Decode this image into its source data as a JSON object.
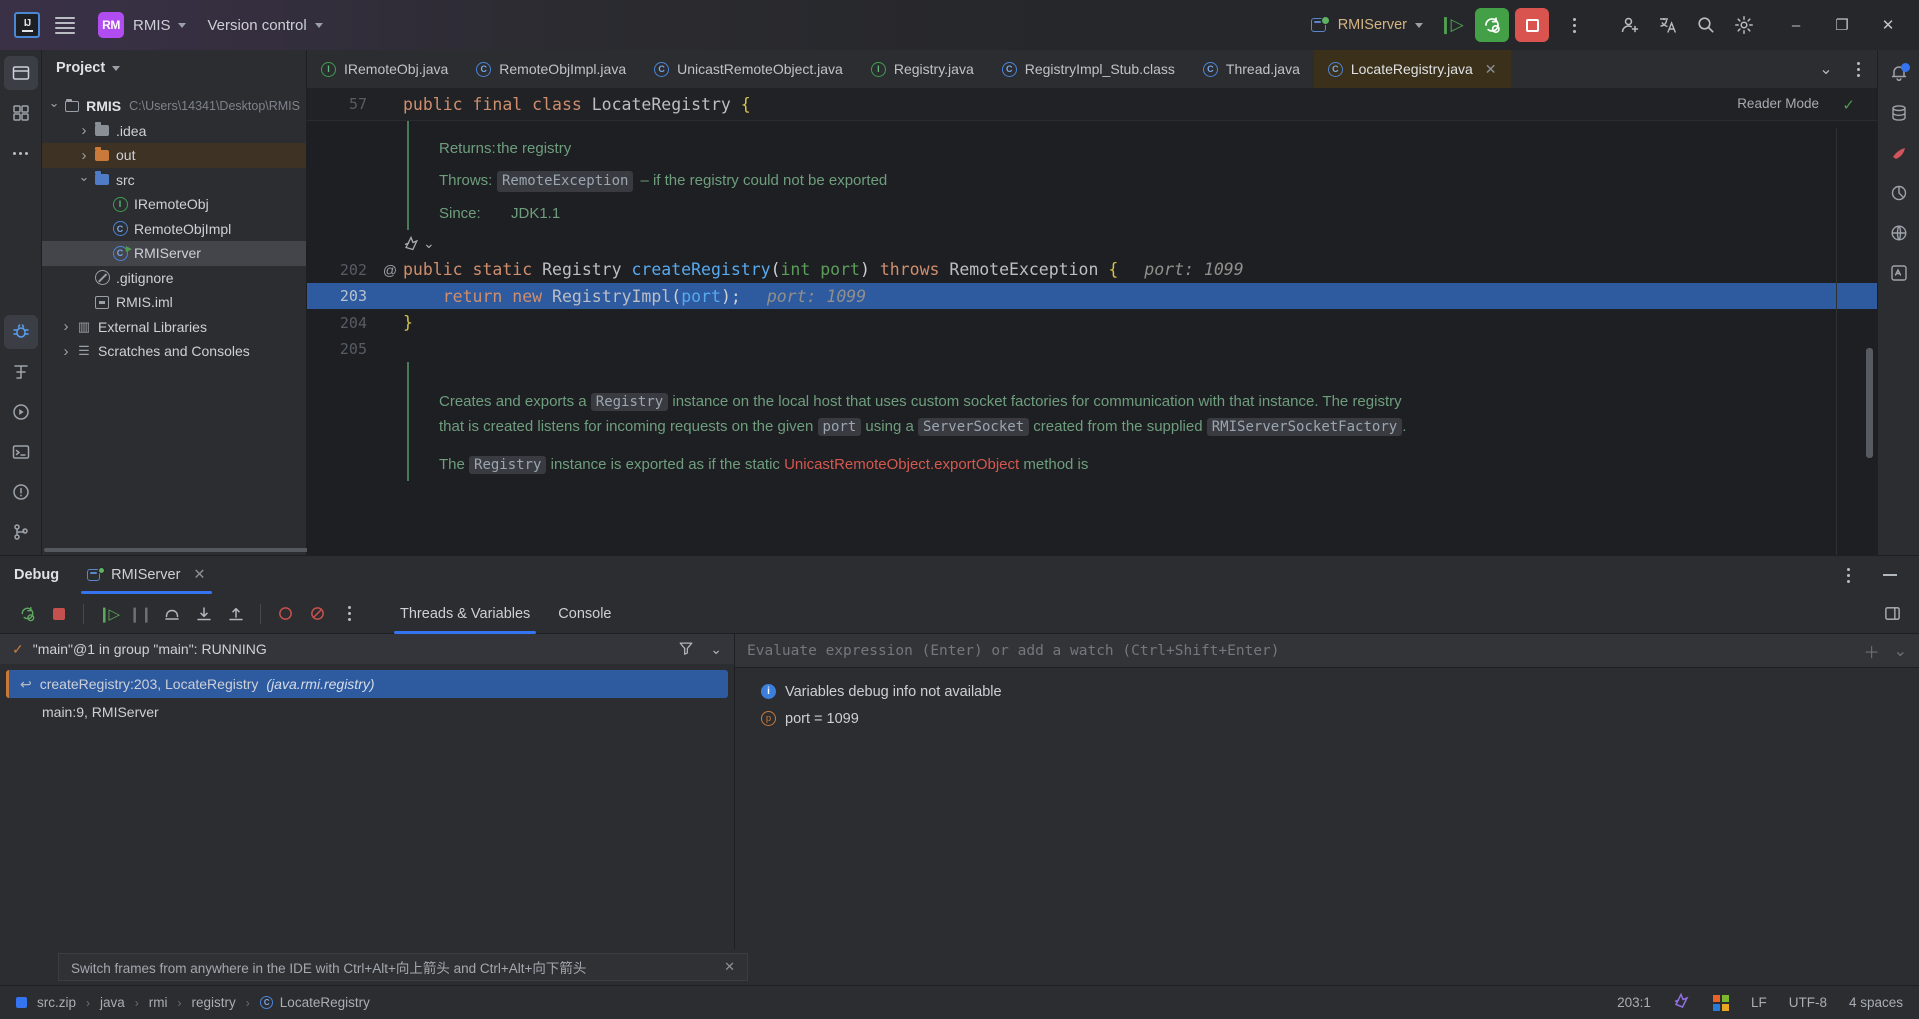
{
  "titlebar": {
    "menu_icon": "hamburger-icon",
    "project_badge": "RM",
    "project_name": "RMIS",
    "vcs_label": "Version control",
    "run_config": "RMIServer",
    "buttons": {
      "resume": "resume-program",
      "debug": "rerun-debug",
      "stop": "stop",
      "more": "more-actions",
      "account": "account",
      "translate": "translate",
      "search": "search",
      "settings": "settings",
      "minimize": "–",
      "maximize": "❐",
      "close": "✕"
    }
  },
  "project": {
    "header": "Project",
    "items": [
      {
        "label": "RMIS",
        "path": "C:\\Users\\14341\\Desktop\\RMIS",
        "icon": "module-folder-icon",
        "arrow": "down",
        "indent": 0,
        "bold": true,
        "state": "normal"
      },
      {
        "label": ".idea",
        "path": "",
        "icon": "folder-grey-icon",
        "arrow": "right",
        "indent": 1,
        "bold": false,
        "state": "normal"
      },
      {
        "label": "out",
        "path": "",
        "icon": "folder-orange-icon",
        "arrow": "right",
        "indent": 1,
        "bold": false,
        "state": "sel-out"
      },
      {
        "label": "src",
        "path": "",
        "icon": "folder-blue-icon",
        "arrow": "down",
        "indent": 1,
        "bold": false,
        "state": "normal"
      },
      {
        "label": "IRemoteObj",
        "path": "",
        "icon": "interface-icon",
        "arrow": "none",
        "indent": 2,
        "bold": false,
        "state": "normal"
      },
      {
        "label": "RemoteObjImpl",
        "path": "",
        "icon": "class-icon",
        "arrow": "none",
        "indent": 2,
        "bold": false,
        "state": "normal"
      },
      {
        "label": "RMIServer",
        "path": "",
        "icon": "runnable-class-icon",
        "arrow": "none",
        "indent": 2,
        "bold": false,
        "state": "sel-grey"
      },
      {
        "label": ".gitignore",
        "path": "",
        "icon": "gitignore-icon",
        "arrow": "none",
        "indent": 1,
        "bold": false,
        "state": "normal"
      },
      {
        "label": "RMIS.iml",
        "path": "",
        "icon": "iml-icon",
        "arrow": "none",
        "indent": 1,
        "bold": false,
        "state": "normal"
      },
      {
        "label": "External Libraries",
        "path": "",
        "icon": "library-icon",
        "arrow": "right",
        "indent": 0,
        "bold": false,
        "state": "normal"
      },
      {
        "label": "Scratches and Consoles",
        "path": "",
        "icon": "scratches-icon",
        "arrow": "right",
        "indent": 0,
        "bold": false,
        "state": "normal"
      }
    ]
  },
  "editor": {
    "tabs": [
      {
        "label": "IRemoteObj.java",
        "icon": "interface-icon",
        "active": false,
        "closable": false
      },
      {
        "label": "RemoteObjImpl.java",
        "icon": "class-icon",
        "active": false,
        "closable": false
      },
      {
        "label": "UnicastRemoteObject.java",
        "icon": "class-icon",
        "active": false,
        "closable": false
      },
      {
        "label": "Registry.java",
        "icon": "interface-icon",
        "active": false,
        "closable": false
      },
      {
        "label": "RegistryImpl_Stub.class",
        "icon": "class-file-icon",
        "active": false,
        "closable": false
      },
      {
        "label": "Thread.java",
        "icon": "class-icon",
        "active": false,
        "closable": false
      },
      {
        "label": "LocateRegistry.java",
        "icon": "class-file-icon",
        "active": true,
        "closable": true
      }
    ],
    "reader_mode": "Reader Mode",
    "sticky": {
      "line_no": "57",
      "tokens": [
        "public",
        "final",
        "class",
        "LocateRegistry",
        "{"
      ]
    },
    "javadoc_top": [
      {
        "key": "Returns:",
        "value": "the registry",
        "chip": ""
      },
      {
        "key": "Throws:",
        "chip": "RemoteException",
        "value": "– if the registry could not be exported"
      },
      {
        "key": "Since:",
        "value": "JDK1.1",
        "chip": ""
      }
    ],
    "code_lines": [
      {
        "line_no": "202",
        "marker": "@",
        "highlighted": false,
        "text": "public static Registry createRegistry(int port) throws RemoteException {",
        "inlay": "port: 1099"
      },
      {
        "line_no": "203",
        "marker": "",
        "highlighted": true,
        "text": "    return new RegistryImpl(port);",
        "inlay": "port: 1099"
      },
      {
        "line_no": "204",
        "marker": "",
        "highlighted": false,
        "text": "}",
        "inlay": ""
      },
      {
        "line_no": "205",
        "marker": "",
        "highlighted": false,
        "text": "",
        "inlay": ""
      }
    ],
    "javadoc_bottom": {
      "para1_a": "Creates and exports a ",
      "chip1": "Registry",
      "para1_b": " instance on the local host that uses custom socket factories for communication with that instance. The registry that is created listens for incoming requests on the given ",
      "chip2": "port",
      "para1_c": " using a ",
      "chip3": "ServerSocket",
      "para1_d": " created from the supplied ",
      "chip4": "RMIServerSocketFactory",
      "para1_e": ".",
      "para2_a": "The ",
      "chip5": "Registry",
      "para2_b": " instance is exported as if the static ",
      "link": "UnicastRemoteObject.exportObject",
      "para2_c": " method is"
    }
  },
  "debug": {
    "title": "Debug",
    "session_tab": "RMIServer",
    "toolbar": [
      {
        "name": "rerun-icon",
        "glyph": "↺",
        "style": "green"
      },
      {
        "name": "stop-icon",
        "glyph": "■",
        "style": "red"
      },
      {
        "name": "resume-icon",
        "glyph": "▶",
        "style": "green"
      },
      {
        "name": "pause-icon",
        "glyph": "‖",
        "style": "dim"
      },
      {
        "name": "step-over-icon",
        "glyph": "⤴",
        "style": "normal"
      },
      {
        "name": "step-into-icon",
        "glyph": "↓",
        "style": "normal"
      },
      {
        "name": "step-out-icon",
        "glyph": "↑",
        "style": "normal"
      },
      {
        "name": "view-breakpoints-icon",
        "glyph": "●",
        "style": "red"
      },
      {
        "name": "mute-breakpoints-icon",
        "glyph": "⊘",
        "style": "red"
      },
      {
        "name": "more-options-icon",
        "glyph": "⋮",
        "style": "normal"
      }
    ],
    "subtabs": [
      {
        "label": "Threads & Variables",
        "active": true
      },
      {
        "label": "Console",
        "active": false
      }
    ],
    "thread_status": "\"main\"@1 in group \"main\": RUNNING",
    "frames": [
      {
        "label": "createRegistry:203, LocateRegistry",
        "package": "(java.rmi.registry)",
        "selected": true
      },
      {
        "label": "main:9, RMIServer",
        "package": "",
        "selected": false
      }
    ],
    "eval_placeholder": "Evaluate expression (Enter) or add a watch (Ctrl+Shift+Enter)",
    "variables": [
      {
        "icon": "info-icon",
        "text": "Variables debug info not available"
      },
      {
        "icon": "parameter-icon",
        "text": "port = 1099"
      }
    ],
    "hint": "Switch frames from anywhere in the IDE with Ctrl+Alt+向上箭头 and Ctrl+Alt+向下箭头"
  },
  "statusbar": {
    "breadcrumbs": [
      "src.zip",
      "java",
      "rmi",
      "registry",
      "LocateRegistry"
    ],
    "position": "203:1",
    "line_sep": "LF",
    "encoding": "UTF-8",
    "indent": "4 spaces"
  },
  "colors": {
    "accent": "#3574f0",
    "selection": "#2e5aa0",
    "tab_active": "#3b3019",
    "brand_purple": "#b14cf0",
    "run_green": "#43a047",
    "stop_red": "#d9534f"
  }
}
